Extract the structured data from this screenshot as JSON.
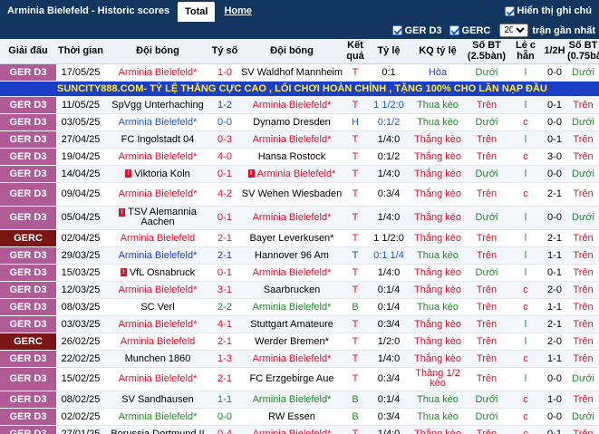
{
  "header": {
    "title": "Arminia Bielefeld - Historic scores",
    "tab_total": "Total",
    "tab_home": "Home",
    "show_notes": "Hiển thị ghi chú"
  },
  "filters": {
    "gerd3": "GER D3",
    "gerc": "GERC",
    "count": "20",
    "last_matches": "trận gần nhất"
  },
  "columns": [
    "Giải đấu",
    "Thời gian",
    "Đội bóng",
    "Tỷ số",
    "Đội bóng",
    "Kết quả",
    "Tỷ lệ",
    "KQ tỷ lệ",
    "Số BT (2.5bàn)",
    "Lẻ c hẵn",
    "1/2H",
    "Số BT (0.75bàn)"
  ],
  "banner": "SUNCITY888.COM- TỶ LỆ THẮNG CỰC CAO , LỐI CHƠI HOÀN CHỈNH , TẶNG 100% CHO LẦN NẠP ĐẦU",
  "rows": [
    {
      "league": "GER D3",
      "date": "17/05/25",
      "home": "Arminia Bielefeld*",
      "score": "1-0",
      "away": "SV Waldhof Mannheim",
      "res": "T",
      "odds": "0:1",
      "kq": "Hòa",
      "bt": "Dưới",
      "lc": "l",
      "h": "0-0",
      "bt2": "Dưới",
      "hc": "red",
      "ac": "",
      "sc": "red",
      "rc": "red",
      "kc": "blue",
      "btc": "green",
      "lcc": "green",
      "bt2c": "green"
    },
    {
      "league": "GER D3",
      "date": "11/05/25",
      "home": "SpVgg Unterhaching",
      "score": "1-2",
      "away": "Arminia Bielefeld*",
      "res": "T",
      "odds": "1 1/2:0",
      "kq": "Thua kèo",
      "bt": "Trên",
      "lc": "l",
      "h": "0-1",
      "bt2": "Trên",
      "hc": "",
      "ac": "red",
      "sc": "blue",
      "rc": "red",
      "kc": "green",
      "btc": "red",
      "lcc": "green",
      "bt2c": "red"
    },
    {
      "league": "GER D3",
      "date": "03/05/25",
      "home": "Arminia Bielefeld*",
      "score": "0-0",
      "away": "Dynamo Dresden",
      "res": "H",
      "odds": "0:1/2",
      "kq": "Thua kèo",
      "bt": "Dưới",
      "lc": "c",
      "h": "0-0",
      "bt2": "Dưới",
      "hc": "dblue",
      "ac": "",
      "sc": "dblue",
      "rc": "dblue",
      "kc": "green",
      "btc": "green",
      "lcc": "red",
      "bt2c": "green"
    },
    {
      "league": "GER D3",
      "date": "27/04/25",
      "home": "FC Ingolstadt 04",
      "score": "0-3",
      "away": "Arminia Bielefeld*",
      "res": "T",
      "odds": "1/4:0",
      "kq": "Thắng kèo",
      "bt": "Trên",
      "lc": "l",
      "h": "0-1",
      "bt2": "Trên",
      "hc": "",
      "ac": "red",
      "sc": "red",
      "rc": "red",
      "kc": "red",
      "btc": "red",
      "lcc": "green",
      "bt2c": "red"
    },
    {
      "league": "GER D3",
      "date": "19/04/25",
      "home": "Arminia Bielefeld*",
      "score": "4-0",
      "away": "Hansa Rostock",
      "res": "T",
      "odds": "0:1/2",
      "kq": "Thắng kèo",
      "bt": "Trên",
      "lc": "c",
      "h": "3-0",
      "bt2": "Trên",
      "hc": "red",
      "ac": "",
      "sc": "red",
      "rc": "red",
      "kc": "red",
      "btc": "red",
      "lcc": "red",
      "bt2c": "red"
    },
    {
      "league": "GER D3",
      "date": "14/04/25",
      "home": "Viktoria Koln",
      "score": "0-1",
      "away": "Arminia Bielefeld*",
      "res": "T",
      "odds": "1/4:0",
      "kq": "Thắng kèo",
      "bt": "Dưới",
      "lc": "l",
      "h": "0-0",
      "bt2": "Dưới",
      "hc": "",
      "ac": "red",
      "sc": "red",
      "rc": "red",
      "kc": "red",
      "btc": "green",
      "lcc": "green",
      "bt2c": "green",
      "homecard": true,
      "awaycard": true
    },
    {
      "league": "GER D3",
      "date": "09/04/25",
      "home": "Arminia Bielefeld*",
      "score": "4-2",
      "away": "SV Wehen Wiesbaden",
      "res": "T",
      "odds": "0:3/4",
      "kq": "Thắng kèo",
      "bt": "Trên",
      "lc": "c",
      "h": "2-1",
      "bt2": "Trên",
      "hc": "red",
      "ac": "",
      "sc": "red",
      "rc": "red",
      "kc": "red",
      "btc": "red",
      "lcc": "red",
      "bt2c": "red",
      "tall": true
    },
    {
      "league": "GER D3",
      "date": "05/04/25",
      "home": "TSV Alemannia Aachen",
      "score": "0-1",
      "away": "Arminia Bielefeld*",
      "res": "T",
      "odds": "1/4:0",
      "kq": "Thắng kèo",
      "bt": "Dưới",
      "lc": "l",
      "h": "0-0",
      "bt2": "Dưới",
      "hc": "",
      "ac": "red",
      "sc": "red",
      "rc": "red",
      "kc": "red",
      "btc": "green",
      "lcc": "green",
      "bt2c": "green",
      "homecard": true,
      "tall": true
    },
    {
      "league": "GERC",
      "date": "02/04/25",
      "home": "Arminia Bielefeld",
      "score": "2-1",
      "away": "Bayer Leverkusen*",
      "res": "T",
      "odds": "1 1/2:0",
      "kq": "Thắng kèo",
      "bt": "Trên",
      "lc": "l",
      "h": "2-1",
      "bt2": "Trên",
      "hc": "red",
      "ac": "",
      "sc": "red",
      "rc": "red",
      "kc": "red",
      "btc": "red",
      "lcc": "green",
      "bt2c": "red"
    },
    {
      "league": "GER D3",
      "date": "29/03/25",
      "home": "Arminia Bielefeld*",
      "score": "2-1",
      "away": "Hannover 96 Am",
      "res": "T",
      "odds": "0:1 1/4",
      "kq": "Thua kèo",
      "bt": "Trên",
      "lc": "l",
      "h": "1-1",
      "bt2": "Trên",
      "hc": "blue",
      "ac": "",
      "sc": "blue",
      "rc": "blue",
      "kc": "green",
      "btc": "red",
      "lcc": "green",
      "bt2c": "red"
    },
    {
      "league": "GER D3",
      "date": "15/03/25",
      "home": "VfL Osnabruck",
      "score": "0-1",
      "away": "Arminia Bielefeld*",
      "res": "T",
      "odds": "1/4:0",
      "kq": "Thắng kèo",
      "bt": "Dưới",
      "lc": "l",
      "h": "0-1",
      "bt2": "Trên",
      "hc": "",
      "ac": "red",
      "sc": "red",
      "rc": "red",
      "kc": "red",
      "btc": "green",
      "lcc": "green",
      "bt2c": "red",
      "homecard": true
    },
    {
      "league": "GER D3",
      "date": "12/03/25",
      "home": "Arminia Bielefeld*",
      "score": "3-1",
      "away": "Saarbrucken",
      "res": "T",
      "odds": "0:1/4",
      "kq": "Thắng kèo",
      "bt": "Trên",
      "lc": "c",
      "h": "2-0",
      "bt2": "Trên",
      "hc": "red",
      "ac": "",
      "sc": "red",
      "rc": "red",
      "kc": "red",
      "btc": "red",
      "lcc": "red",
      "bt2c": "red"
    },
    {
      "league": "GER D3",
      "date": "08/03/25",
      "home": "SC Verl",
      "score": "2-2",
      "away": "Arminia Bielefeld*",
      "res": "B",
      "odds": "0:1/4",
      "kq": "Thua kèo",
      "bt": "Trên",
      "lc": "c",
      "h": "1-1",
      "bt2": "Trên",
      "hc": "",
      "ac": "green",
      "sc": "green",
      "rc": "green",
      "kc": "green",
      "btc": "red",
      "lcc": "red",
      "bt2c": "red"
    },
    {
      "league": "GER D3",
      "date": "03/03/25",
      "home": "Arminia Bielefeld*",
      "score": "4-1",
      "away": "Stuttgart Amateure",
      "res": "T",
      "odds": "0:3/4",
      "kq": "Thắng kèo",
      "bt": "Trên",
      "lc": "l",
      "h": "2-1",
      "bt2": "Trên",
      "hc": "red",
      "ac": "",
      "sc": "red",
      "rc": "red",
      "kc": "red",
      "btc": "red",
      "lcc": "green",
      "bt2c": "red"
    },
    {
      "league": "GERC",
      "date": "26/02/25",
      "home": "Arminia Bielefeld",
      "score": "2-1",
      "away": "Werder Bremen*",
      "res": "T",
      "odds": "1/2:0",
      "kq": "Thắng kèo",
      "bt": "Trên",
      "lc": "l",
      "h": "2-0",
      "bt2": "Trên",
      "hc": "red",
      "ac": "",
      "sc": "red",
      "rc": "red",
      "kc": "red",
      "btc": "red",
      "lcc": "green",
      "bt2c": "red"
    },
    {
      "league": "GER D3",
      "date": "22/02/25",
      "home": "Munchen 1860",
      "score": "1-3",
      "away": "Arminia Bielefeld*",
      "res": "T",
      "odds": "1/4:0",
      "kq": "Thắng kèo",
      "bt": "Trên",
      "lc": "c",
      "h": "1-1",
      "bt2": "Trên",
      "hc": "",
      "ac": "red",
      "sc": "red",
      "rc": "red",
      "kc": "red",
      "btc": "red",
      "lcc": "red",
      "bt2c": "red"
    },
    {
      "league": "GER D3",
      "date": "15/02/25",
      "home": "Arminia Bielefeld*",
      "score": "2-1",
      "away": "FC Erzgebirge Aue",
      "res": "T",
      "odds": "0:3/4",
      "kq": "Thắng 1/2 kèo",
      "bt": "Trên",
      "lc": "l",
      "h": "0-0",
      "bt2": "Dưới",
      "hc": "red",
      "ac": "",
      "sc": "red",
      "rc": "red",
      "kc": "red",
      "btc": "red",
      "lcc": "green",
      "bt2c": "green",
      "tall": true
    },
    {
      "league": "GER D3",
      "date": "08/02/25",
      "home": "SV Sandhausen",
      "score": "1-1",
      "away": "Arminia Bielefeld*",
      "res": "B",
      "odds": "0:1/4",
      "kq": "Thua kèo",
      "bt": "Dưới",
      "lc": "c",
      "h": "1-0",
      "bt2": "Trên",
      "hc": "",
      "ac": "green",
      "sc": "green",
      "rc": "green",
      "kc": "green",
      "btc": "green",
      "lcc": "red",
      "bt2c": "red"
    },
    {
      "league": "GER D3",
      "date": "02/02/25",
      "home": "Arminia Bielefeld*",
      "score": "0-0",
      "away": "RW Essen",
      "res": "B",
      "odds": "0:3/4",
      "kq": "Thua kèo",
      "bt": "Dưới",
      "lc": "c",
      "h": "0-0",
      "bt2": "Dưới",
      "hc": "green",
      "ac": "",
      "sc": "green",
      "rc": "green",
      "kc": "green",
      "btc": "green",
      "lcc": "red",
      "bt2c": "green"
    },
    {
      "league": "GER D3",
      "date": "27/01/25",
      "home": "Borussia Dortmund II",
      "score": "0-4",
      "away": "Arminia Bielefeld*",
      "res": "T",
      "odds": "1/4:0",
      "kq": "Thắng kèo",
      "bt": "Trên",
      "lc": "c",
      "h": "0-1",
      "bt2": "Trên",
      "hc": "",
      "ac": "red",
      "sc": "red",
      "rc": "red",
      "kc": "red",
      "btc": "red",
      "lcc": "red",
      "bt2c": "red"
    }
  ]
}
